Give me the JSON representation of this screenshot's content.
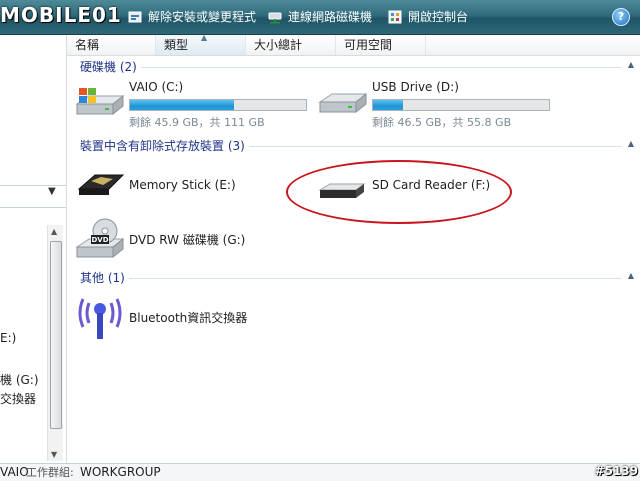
{
  "toolbar": {
    "watermark": "MOBILE01",
    "uninstall_label": "解除安裝或變更程式",
    "map_drive_label": "連線網路磁碟機",
    "control_panel_label": "開啟控制台"
  },
  "nav": {
    "partial_items": [
      "E:)",
      "機 (G:)",
      "交換器"
    ]
  },
  "columns": [
    "名稱",
    "類型",
    "大小總計",
    "可用空間"
  ],
  "groups": {
    "hard_drives": "硬碟機 (2)",
    "removable": "裝置中含有卸除式存放裝置 (3)",
    "other": "其他 (1)"
  },
  "drives": [
    {
      "name": "VAIO (C:)",
      "free_text": "剩餘 45.9 GB，共 111 GB",
      "used_fraction": 0.59
    },
    {
      "name": "USB Drive (D:)",
      "free_text": "剩餘 46.5 GB，共 55.8 GB",
      "used_fraction": 0.17
    }
  ],
  "removable": [
    {
      "name": "Memory Stick (E:)"
    },
    {
      "name": "SD Card Reader (F:)"
    },
    {
      "name": "DVD RW 磁碟機 (G:)"
    }
  ],
  "other": [
    {
      "name": "Bluetooth資訊交換器"
    }
  ],
  "status": {
    "computer": "VAIO",
    "workgroup_label": "工作群組:",
    "workgroup": "WORKGROUP"
  },
  "photo_id": "#5139",
  "colors": {
    "group_title": "#1e3287",
    "bar_fill": "#1f95d8",
    "annotation": "#c8161d"
  }
}
